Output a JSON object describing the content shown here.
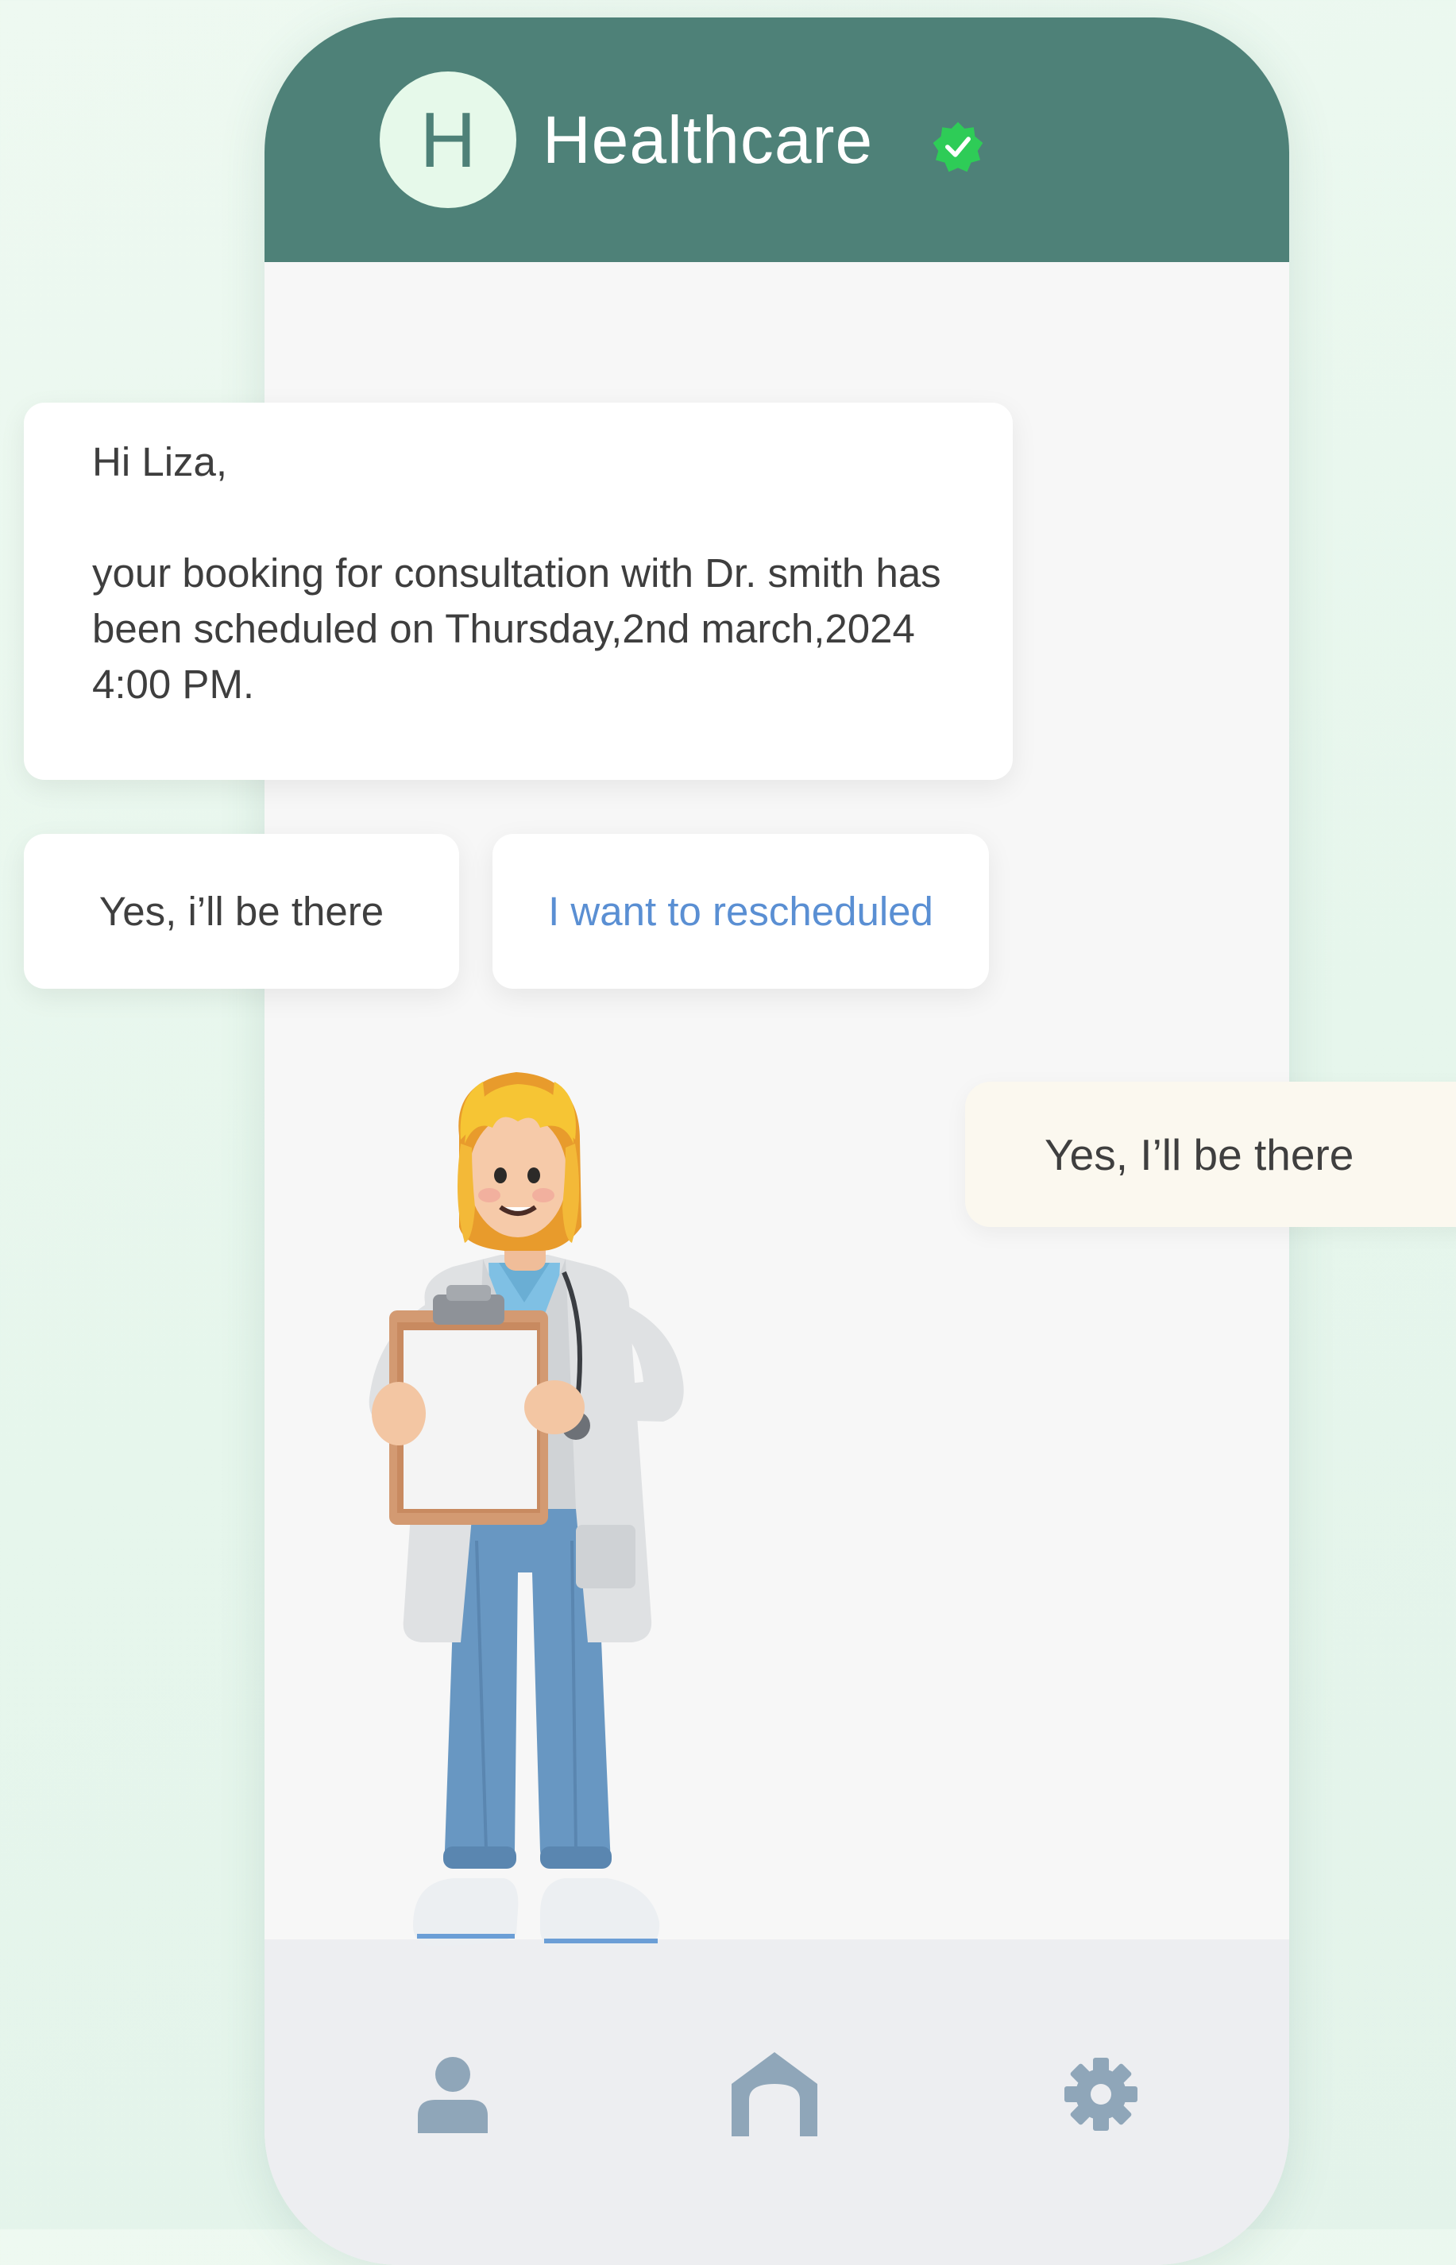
{
  "header": {
    "avatar_letter": "H",
    "title": "Healthcare",
    "verified_icon": "verified-check-icon"
  },
  "message": {
    "greeting": "Hi Liza,",
    "body": "your booking for consultation with Dr. smith has been scheduled on Thursday,2nd march,2024 4:00 PM."
  },
  "quick_replies": [
    {
      "label": "Yes, i’ll be there"
    },
    {
      "label": "I want to rescheduled"
    }
  ],
  "reply": {
    "text": "Yes, I’ll be there"
  },
  "bottom_nav": [
    {
      "icon": "user-icon"
    },
    {
      "icon": "home-icon"
    },
    {
      "icon": "gear-icon"
    }
  ],
  "colors": {
    "header": "#4e8178",
    "accent_link": "#5a8fd3",
    "verified": "#2ecc57",
    "nav_icon": "#8fa6b9",
    "reply_bubble": "#fbf8ef"
  }
}
